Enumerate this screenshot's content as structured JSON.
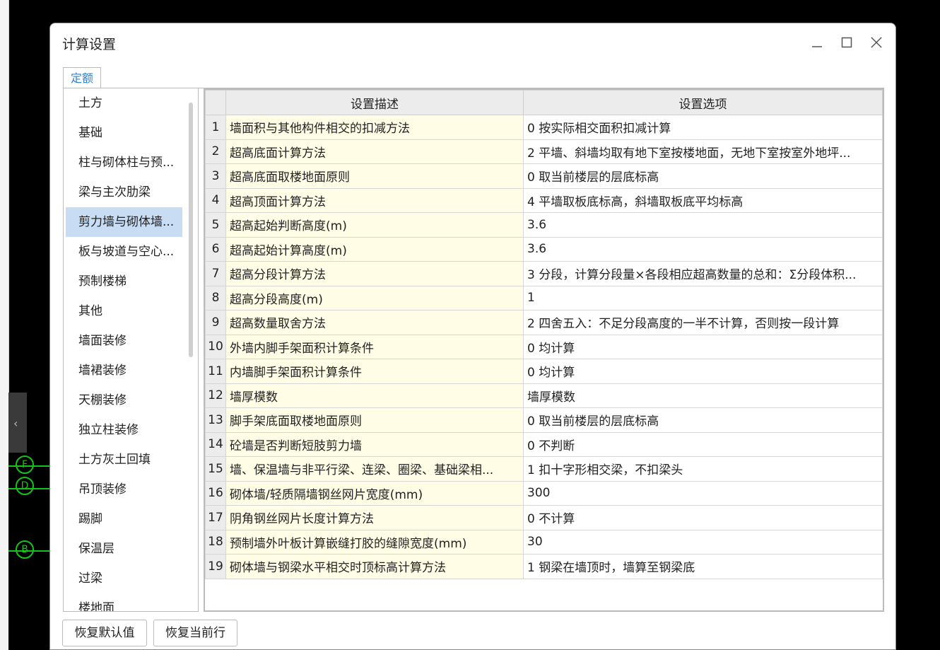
{
  "dialog": {
    "title": "计算设置",
    "minimize_icon": "minimize-icon",
    "maximize_icon": "maximize-icon",
    "close_icon": "close-icon",
    "tab_label": "定额"
  },
  "background": {
    "collapse_arrow": "‹",
    "axis_labels": [
      "F",
      "D",
      "B"
    ]
  },
  "categories": [
    {
      "label": "土方",
      "selected": false
    },
    {
      "label": "基础",
      "selected": false
    },
    {
      "label": "柱与砌体柱与预...",
      "selected": false
    },
    {
      "label": "梁与主次肋梁",
      "selected": false
    },
    {
      "label": "剪力墙与砌体墙...",
      "selected": true
    },
    {
      "label": "板与坡道与空心...",
      "selected": false
    },
    {
      "label": "预制楼梯",
      "selected": false
    },
    {
      "label": "其他",
      "selected": false
    },
    {
      "label": "墙面装修",
      "selected": false
    },
    {
      "label": "墙裙装修",
      "selected": false
    },
    {
      "label": "天棚装修",
      "selected": false
    },
    {
      "label": "独立柱装修",
      "selected": false
    },
    {
      "label": "土方灰土回填",
      "selected": false
    },
    {
      "label": "吊顶装修",
      "selected": false
    },
    {
      "label": "踢脚",
      "selected": false
    },
    {
      "label": "保温层",
      "selected": false
    },
    {
      "label": "过梁",
      "selected": false
    },
    {
      "label": "楼地面",
      "selected": false
    }
  ],
  "table": {
    "headers": [
      "",
      "设置描述",
      "设置选项"
    ],
    "rows": [
      {
        "no": "1",
        "desc": "墙面积与其他构件相交的扣减方法",
        "opt": "0 按实际相交面积扣减计算"
      },
      {
        "no": "2",
        "desc": "超高底面计算方法",
        "opt": "2 平墙、斜墙均取有地下室按楼地面，无地下室按室外地坪..."
      },
      {
        "no": "3",
        "desc": "超高底面取楼地面原则",
        "opt": "0 取当前楼层的层底标高"
      },
      {
        "no": "4",
        "desc": "超高顶面计算方法",
        "opt": "4 平墙取板底标高，斜墙取板底平均标高"
      },
      {
        "no": "5",
        "desc": "超高起始判断高度(m)",
        "opt": "3.6"
      },
      {
        "no": "6",
        "desc": "超高起始计算高度(m)",
        "opt": "3.6"
      },
      {
        "no": "7",
        "desc": "超高分段计算方法",
        "opt": "3 分段，计算分段量×各段相应超高数量的总和：Σ分段体积..."
      },
      {
        "no": "8",
        "desc": "超高分段高度(m)",
        "opt": "1"
      },
      {
        "no": "9",
        "desc": "超高数量取舍方法",
        "opt": "2 四舍五入：不足分段高度的一半不计算，否则按一段计算"
      },
      {
        "no": "10",
        "desc": "外墙内脚手架面积计算条件",
        "opt": "0 均计算"
      },
      {
        "no": "11",
        "desc": "内墙脚手架面积计算条件",
        "opt": "0 均计算"
      },
      {
        "no": "12",
        "desc": "墙厚模数",
        "opt": "墙厚模数"
      },
      {
        "no": "13",
        "desc": "脚手架底面取楼地面原则",
        "opt": "0 取当前楼层的层底标高"
      },
      {
        "no": "14",
        "desc": "砼墙是否判断短肢剪力墙",
        "opt": "0 不判断"
      },
      {
        "no": "15",
        "desc": "墙、保温墙与非平行梁、连梁、圈梁、基础梁相...",
        "opt": "1 扣十字形相交梁，不扣梁头"
      },
      {
        "no": "16",
        "desc": "砌体墙/轻质隔墙钢丝网片宽度(mm)",
        "opt": "300"
      },
      {
        "no": "17",
        "desc": "阴角钢丝网片长度计算方法",
        "opt": "0 不计算"
      },
      {
        "no": "18",
        "desc": "预制墙外叶板计算嵌缝打胶的缝隙宽度(mm)",
        "opt": "30"
      },
      {
        "no": "19",
        "desc": "砌体墙与钢梁水平相交时顶标高计算方法",
        "opt": "1 钢梁在墙顶时，墙算至钢梁底"
      }
    ]
  },
  "footer": {
    "restore_default": "恢复默认值",
    "restore_current": "恢复当前行"
  }
}
